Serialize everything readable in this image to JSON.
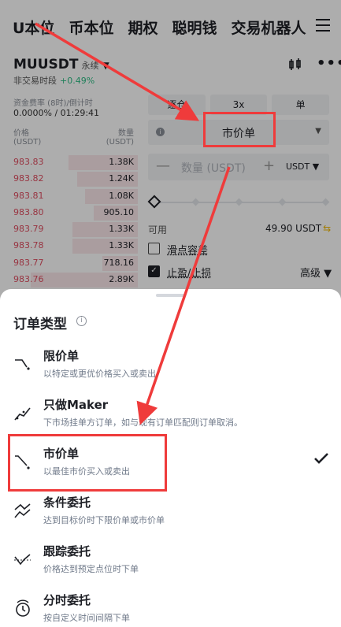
{
  "nav": {
    "items": [
      "U本位",
      "币本位",
      "期权",
      "聪明钱",
      "交易机器人"
    ]
  },
  "symbol": {
    "name": "MUUSDT",
    "tag": "永续",
    "status": "非交易时段",
    "change": "+0.49%"
  },
  "funding": {
    "label": "资金费率 (8时)/倒计时",
    "value": "0.0000% / 01:29:41"
  },
  "orderbook": {
    "price_header": "价格",
    "price_unit": "(USDT)",
    "qty_header": "数量",
    "qty_unit": "(USDT)",
    "rows": [
      {
        "price": "983.83",
        "qty": "1.38K",
        "depth": 0.55
      },
      {
        "price": "983.82",
        "qty": "1.24K",
        "depth": 0.48
      },
      {
        "price": "983.81",
        "qty": "1.08K",
        "depth": 0.42
      },
      {
        "price": "983.80",
        "qty": "905.10",
        "depth": 0.35
      },
      {
        "price": "983.79",
        "qty": "1.33K",
        "depth": 0.52
      },
      {
        "price": "983.78",
        "qty": "1.33K",
        "depth": 0.52
      },
      {
        "price": "983.77",
        "qty": "718.16",
        "depth": 0.28
      },
      {
        "price": "983.76",
        "qty": "2.89K",
        "depth": 0.85
      }
    ]
  },
  "form": {
    "margin_mode": "逐仓",
    "leverage": "3x",
    "mode": "单",
    "order_type": "市价单",
    "qty_placeholder": "数量 (USDT)",
    "qty_unit": "USDT",
    "available_label": "可用",
    "available_value": "49.90 USDT",
    "slippage_label": "滑点容差",
    "tpsl_label": "止盈/止损",
    "advanced": "高级"
  },
  "sheet": {
    "title": "订单类型",
    "options": [
      {
        "label": "限价单",
        "desc": "以特定或更优价格买入或卖出",
        "icon": "limit-order-icon",
        "selected": false
      },
      {
        "label": "只做Maker",
        "desc": "下市场挂单方订单，如与现有订单匹配则订单取消。",
        "icon": "maker-only-icon",
        "selected": false
      },
      {
        "label": "市价单",
        "desc": "以最佳市价买入或卖出",
        "icon": "market-order-icon",
        "selected": true
      },
      {
        "label": "条件委托",
        "desc": "达到目标价时下限价单或市价单",
        "icon": "conditional-order-icon",
        "selected": false
      },
      {
        "label": "跟踪委托",
        "desc": "价格达到预定点位时下单",
        "icon": "trailing-order-icon",
        "selected": false
      },
      {
        "label": "分时委托",
        "desc": "按自定义时间间隔下单",
        "icon": "twap-order-icon",
        "selected": false
      }
    ]
  },
  "colors": {
    "highlight": "#ef3b3b",
    "ask": "#e14f62",
    "up": "#2ebd85"
  }
}
